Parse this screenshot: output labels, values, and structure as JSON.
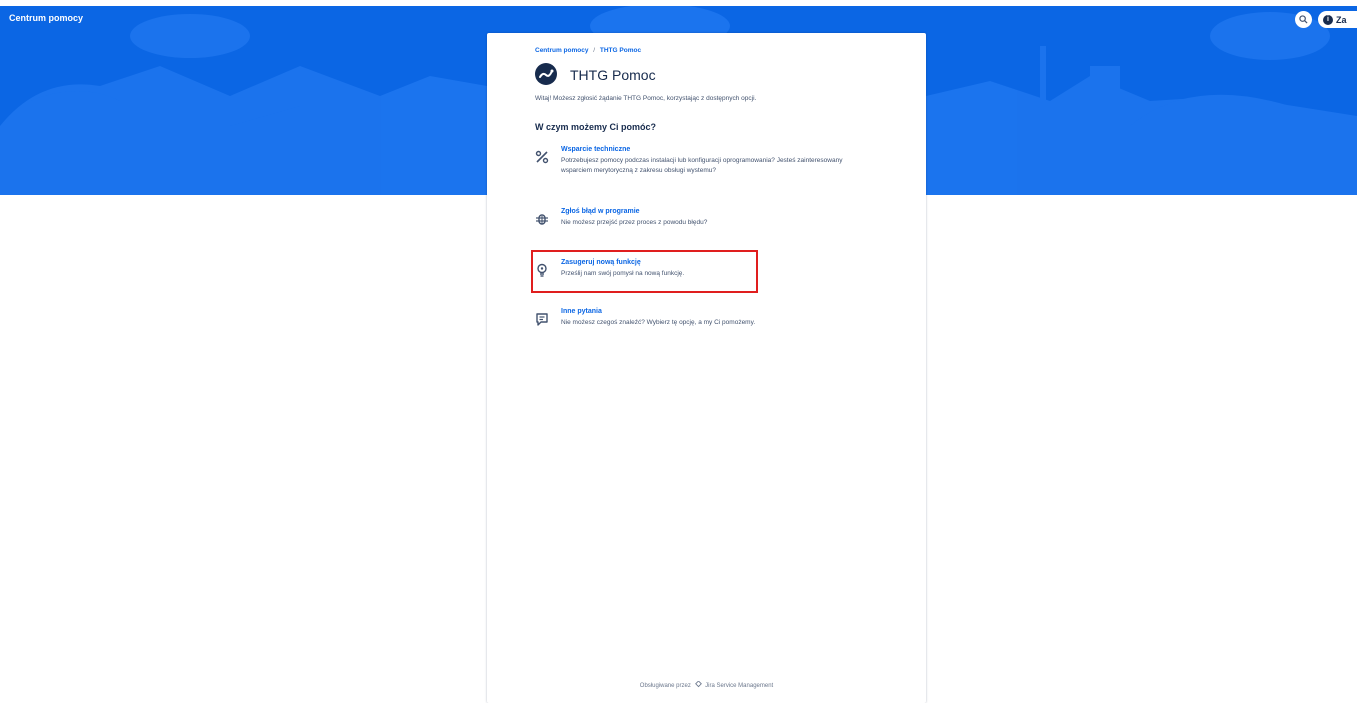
{
  "header": {
    "brand": "Centrum pomocy",
    "login_label": "Za"
  },
  "breadcrumb": {
    "root": "Centrum pomocy",
    "separator": "/",
    "current": "THTG Pomoc"
  },
  "project": {
    "title": "THTG Pomoc",
    "welcome": "Witaj! Możesz zgłosić żądanie THTG Pomoc, korzystając z dostępnych opcji."
  },
  "question": "W czym możemy Ci pomóc?",
  "options": [
    {
      "icon": "tools-icon",
      "title": "Wsparcie techniczne",
      "description": "Potrzebujesz pomocy podczas instalacji lub konfiguracji oprogramowania? Jesteś zainteresowany wsparciem merytoryczną z zakresu obsługi wystemu?"
    },
    {
      "icon": "bug-icon",
      "title": "Zgłoś błąd w programie",
      "description": "Nie możesz przejść przez proces z powodu błędu?"
    },
    {
      "icon": "lightbulb-icon",
      "title": "Zasugeruj nową funkcję",
      "description": "Prześlij nam swój pomysł na nową funkcję."
    },
    {
      "icon": "chat-icon",
      "title": "Inne pytania",
      "description": "Nie możesz czegoś znaleźć? Wybierz tę opcję, a my Ci pomożemy."
    }
  ],
  "footer": {
    "powered_by": "Obsługiwane przez",
    "product": "Jira Service Management"
  },
  "colors": {
    "banner": "#0b66e4",
    "link": "#0b66e4",
    "highlight": "#e01e1e"
  }
}
